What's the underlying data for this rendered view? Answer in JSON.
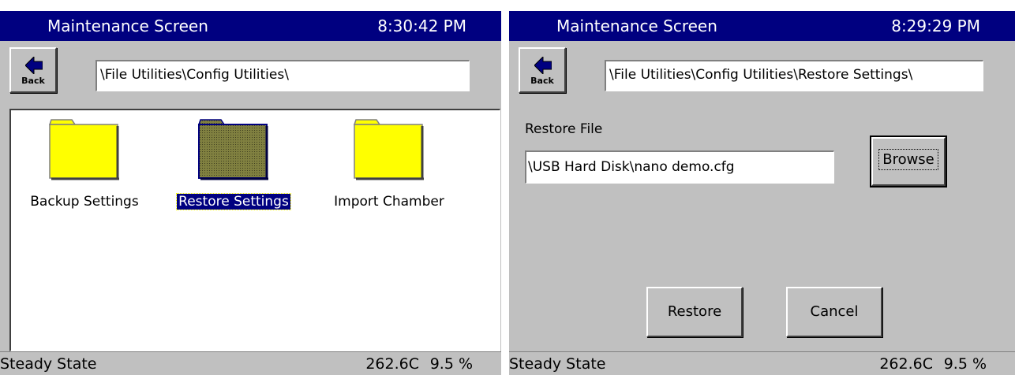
{
  "left": {
    "title": "Maintenance Screen",
    "clock": "8:30:42 PM",
    "back_label": "Back",
    "path": "\\File Utilities\\Config Utilities\\",
    "folders": [
      {
        "label": "Backup Settings",
        "selected": false
      },
      {
        "label": "Restore Settings",
        "selected": true
      },
      {
        "label": "Import Chamber",
        "selected": false
      }
    ],
    "status": {
      "state": "Steady State",
      "temperature": "262.6C",
      "percent": "9.5 %"
    }
  },
  "right": {
    "title": "Maintenance Screen",
    "clock": "8:29:29 PM",
    "back_label": "Back",
    "path": "\\File Utilities\\Config Utilities\\Restore Settings\\",
    "restore_file_label": "Restore File",
    "restore_file_value": "\\USB Hard Disk\\nano demo.cfg",
    "browse_label": "Browse",
    "restore_label": "Restore",
    "cancel_label": "Cancel",
    "status": {
      "state": "Steady State",
      "temperature": "262.6C",
      "percent": "9.5 %"
    }
  },
  "colors": {
    "titlebar": "#000080",
    "panel": "#c0c0c0",
    "folder_yellow": "#ffff00",
    "folder_selected": "#808040"
  },
  "icons": [
    "back-arrow-icon",
    "folder-icon"
  ]
}
